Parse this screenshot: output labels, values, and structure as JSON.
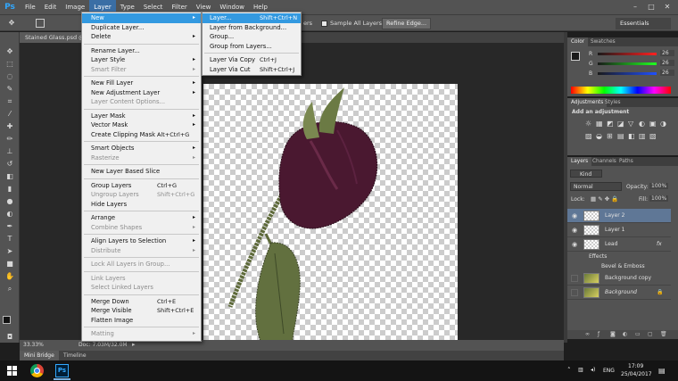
{
  "app": {
    "logo": "Ps",
    "menus": [
      "File",
      "Edit",
      "Image",
      "Layer",
      "Type",
      "Select",
      "Filter",
      "View",
      "Window",
      "Help"
    ],
    "active_menu": "Layer"
  },
  "window_controls": {
    "minimize": "–",
    "maximize": "□",
    "close": "✕"
  },
  "options_bar": {
    "sample_all_layers_fragment": "ers",
    "sample_all_layers": "Sample All Layers",
    "refine_edge": "Refine Edge...",
    "workspace": "Essentials"
  },
  "document": {
    "tab_title": "Stained Glass.psd @",
    "zoom": "33.33%",
    "doc_size": "Doc: 7.03M/32.0M"
  },
  "bottom_tabs": [
    "Mini Bridge",
    "Timeline"
  ],
  "layer_menu": [
    {
      "label": "New",
      "submenu": true,
      "highlighted": true
    },
    {
      "label": "Duplicate Layer..."
    },
    {
      "label": "Delete",
      "submenu": true
    },
    {
      "sep": true
    },
    {
      "label": "Rename Layer..."
    },
    {
      "label": "Layer Style",
      "submenu": true
    },
    {
      "label": "Smart Filter",
      "submenu": true,
      "disabled": true
    },
    {
      "sep": true
    },
    {
      "label": "New Fill Layer",
      "submenu": true
    },
    {
      "label": "New Adjustment Layer",
      "submenu": true
    },
    {
      "label": "Layer Content Options...",
      "disabled": true
    },
    {
      "sep": true
    },
    {
      "label": "Layer Mask",
      "submenu": true
    },
    {
      "label": "Vector Mask",
      "submenu": true
    },
    {
      "label": "Create Clipping Mask",
      "shortcut": "Alt+Ctrl+G"
    },
    {
      "sep": true
    },
    {
      "label": "Smart Objects",
      "submenu": true
    },
    {
      "label": "Rasterize",
      "submenu": true,
      "disabled": true
    },
    {
      "sep": true
    },
    {
      "label": "New Layer Based Slice"
    },
    {
      "sep": true
    },
    {
      "label": "Group Layers",
      "shortcut": "Ctrl+G"
    },
    {
      "label": "Ungroup Layers",
      "shortcut": "Shift+Ctrl+G",
      "disabled": true
    },
    {
      "label": "Hide Layers"
    },
    {
      "sep": true
    },
    {
      "label": "Arrange",
      "submenu": true
    },
    {
      "label": "Combine Shapes",
      "submenu": true,
      "disabled": true
    },
    {
      "sep": true
    },
    {
      "label": "Align Layers to Selection",
      "submenu": true
    },
    {
      "label": "Distribute",
      "submenu": true,
      "disabled": true
    },
    {
      "sep": true
    },
    {
      "label": "Lock All Layers in Group...",
      "disabled": true
    },
    {
      "sep": true
    },
    {
      "label": "Link Layers",
      "disabled": true
    },
    {
      "label": "Select Linked Layers",
      "disabled": true
    },
    {
      "sep": true
    },
    {
      "label": "Merge Down",
      "shortcut": "Ctrl+E"
    },
    {
      "label": "Merge Visible",
      "shortcut": "Shift+Ctrl+E"
    },
    {
      "label": "Flatten Image"
    },
    {
      "sep": true
    },
    {
      "label": "Matting",
      "submenu": true,
      "disabled": true
    }
  ],
  "new_submenu": [
    {
      "label": "Layer...",
      "shortcut": "Shift+Ctrl+N",
      "highlighted": true
    },
    {
      "label": "Layer from Background..."
    },
    {
      "label": "Group..."
    },
    {
      "label": "Group from Layers..."
    },
    {
      "sep": true
    },
    {
      "label": "Layer Via Copy",
      "shortcut": "Ctrl+J"
    },
    {
      "label": "Layer Via Cut",
      "shortcut": "Shift+Ctrl+J"
    }
  ],
  "color_panel": {
    "tabs": [
      "Color",
      "Swatches"
    ],
    "channels": [
      {
        "name": "R",
        "value": "26"
      },
      {
        "name": "G",
        "value": "26"
      },
      {
        "name": "B",
        "value": "26"
      }
    ]
  },
  "adjustments_panel": {
    "tabs": [
      "Adjustments",
      "Styles"
    ],
    "heading": "Add an adjustment"
  },
  "layers_panel": {
    "tabs": [
      "Layers",
      "Channels",
      "Paths"
    ],
    "filter_kind": "Kind",
    "blend_mode": "Normal",
    "opacity_label": "Opacity:",
    "opacity": "100%",
    "lock_label": "Lock:",
    "fill_label": "Fill:",
    "fill": "100%",
    "layers": [
      {
        "name": "Layer 2",
        "selected": true,
        "visible": true
      },
      {
        "name": "Layer 1",
        "visible": true
      },
      {
        "name": "Lead",
        "visible": true,
        "fx": "fx"
      },
      {
        "name": "Effects",
        "effect": true
      },
      {
        "name": "Bevel & Emboss",
        "effect": true
      },
      {
        "name": "Background copy",
        "visible": false
      },
      {
        "name": "Background",
        "visible": false,
        "locked": true
      }
    ]
  },
  "taskbar": {
    "language": "ENG",
    "time": "17:09",
    "date": "25/04/2017"
  },
  "colors": {
    "ui_bg": "#535353",
    "menu_highlight": "#3399e0",
    "rose": "#4a1830",
    "stem": "#5e6a3a"
  }
}
